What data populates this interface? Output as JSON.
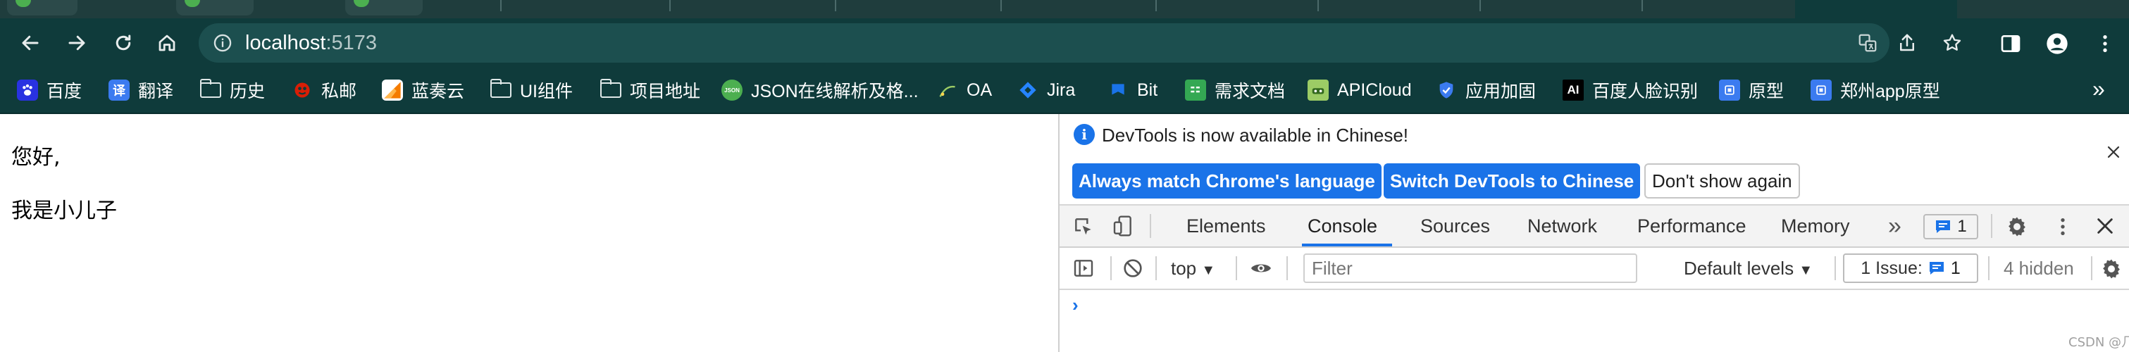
{
  "browser": {
    "url_host": "localhost",
    "url_port": ":5173"
  },
  "bookmarks": [
    {
      "label": "百度",
      "icon": "baidu-paw-icon",
      "color": "#2932e1"
    },
    {
      "label": "翻译",
      "icon": "translate-icon",
      "glyph": "译",
      "color": "#3b7bf0"
    },
    {
      "label": "历史",
      "icon": "folder-icon"
    },
    {
      "label": "私邮",
      "icon": "mail-icon",
      "color": "#d81e06"
    },
    {
      "label": "蓝奏云",
      "icon": "lanzou-icon",
      "color": "#f57c00"
    },
    {
      "label": "UI组件",
      "icon": "folder-icon"
    },
    {
      "label": "项目地址",
      "icon": "folder-icon"
    },
    {
      "label": "JSON在线解析及格...",
      "icon": "json-icon",
      "glyph": "JSON",
      "color": "#4caf50"
    },
    {
      "label": "OA",
      "icon": "oa-icon"
    },
    {
      "label": "Jira",
      "icon": "jira-icon",
      "color": "#2684ff"
    },
    {
      "label": "Bit",
      "icon": "bit-icon",
      "color": "#1a73e8"
    },
    {
      "label": "需求文档",
      "icon": "doc-icon",
      "color": "#34a853"
    },
    {
      "label": "APICloud",
      "icon": "apicloud-icon",
      "color": "#9ccc65"
    },
    {
      "label": "应用加固",
      "icon": "shield-icon",
      "color": "#3b7bf0"
    },
    {
      "label": "百度人脸识别",
      "icon": "ai-icon",
      "glyph": "AI",
      "color": "#000000"
    },
    {
      "label": "原型",
      "icon": "prototype-icon",
      "color": "#3b7bf0"
    },
    {
      "label": "郑州app原型",
      "icon": "prototype-icon",
      "color": "#3b7bf0"
    }
  ],
  "bookmarks_more": "»",
  "page": {
    "line1": "您好,",
    "line2": "我是小儿子"
  },
  "devtools": {
    "infobar": {
      "message": "DevTools is now available in Chinese!",
      "btn_match": "Always match Chrome's language",
      "btn_switch": "Switch DevTools to Chinese",
      "btn_dismiss": "Don't show again"
    },
    "tabs": [
      "Elements",
      "Console",
      "Sources",
      "Network",
      "Performance",
      "Memory"
    ],
    "active_tab": "Console",
    "more_tabs": "»",
    "issues_badge_count": "1",
    "console": {
      "context": "top",
      "filter_placeholder": "Filter",
      "levels": "Default levels",
      "issue_label": "1 Issue:",
      "issue_count": "1",
      "hidden": "4 hidden",
      "prompt": "›"
    }
  },
  "watermark": "CSDN @几何心凉",
  "colors": {
    "chrome_bg": "#0f3b3b",
    "accent": "#1a73e8"
  }
}
